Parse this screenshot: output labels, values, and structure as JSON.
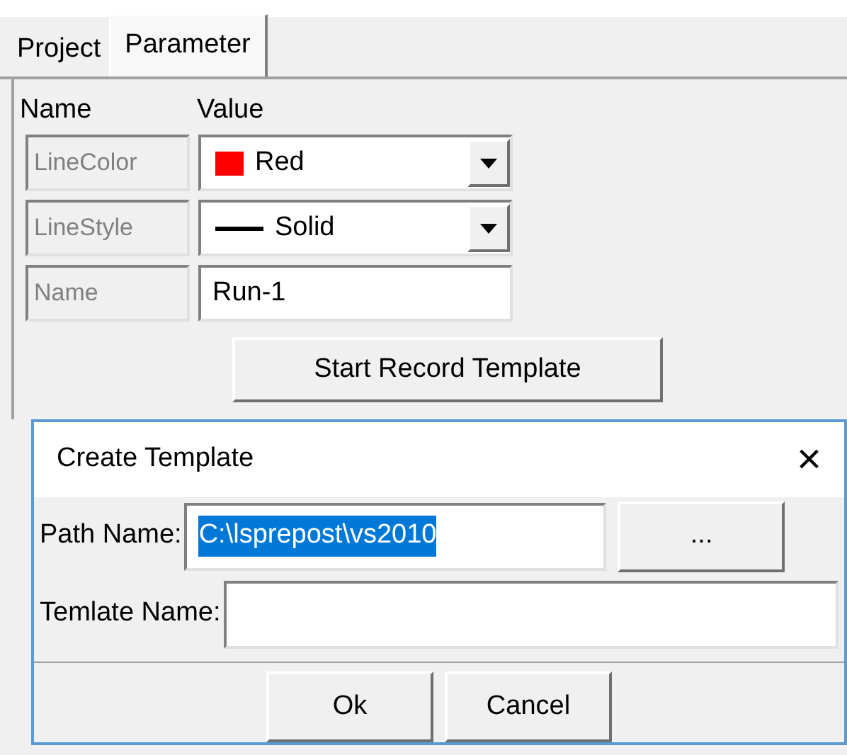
{
  "tabs": [
    {
      "label": "Project",
      "selected": false
    },
    {
      "label": "Parameter",
      "selected": true
    }
  ],
  "table": {
    "columns": [
      "Name",
      "Value"
    ],
    "rows": [
      {
        "kind": "color",
        "name": "LineColor",
        "value": "Red",
        "color": "#ff0000"
      },
      {
        "kind": "line",
        "name": "LineStyle",
        "value": "Solid"
      },
      {
        "kind": "text",
        "name": "Name",
        "value": "Run-1"
      }
    ]
  },
  "start_button": "Start Record Template",
  "dialog": {
    "title": "Create Template",
    "close": "×",
    "fields": [
      {
        "label": "Path Name:",
        "value": "C:\\lsprepost\\vs2010",
        "text_selected": true,
        "browse": "..."
      },
      {
        "label": "Temlate Name:"
      }
    ],
    "buttons": [
      "Ok",
      "Cancel"
    ]
  }
}
